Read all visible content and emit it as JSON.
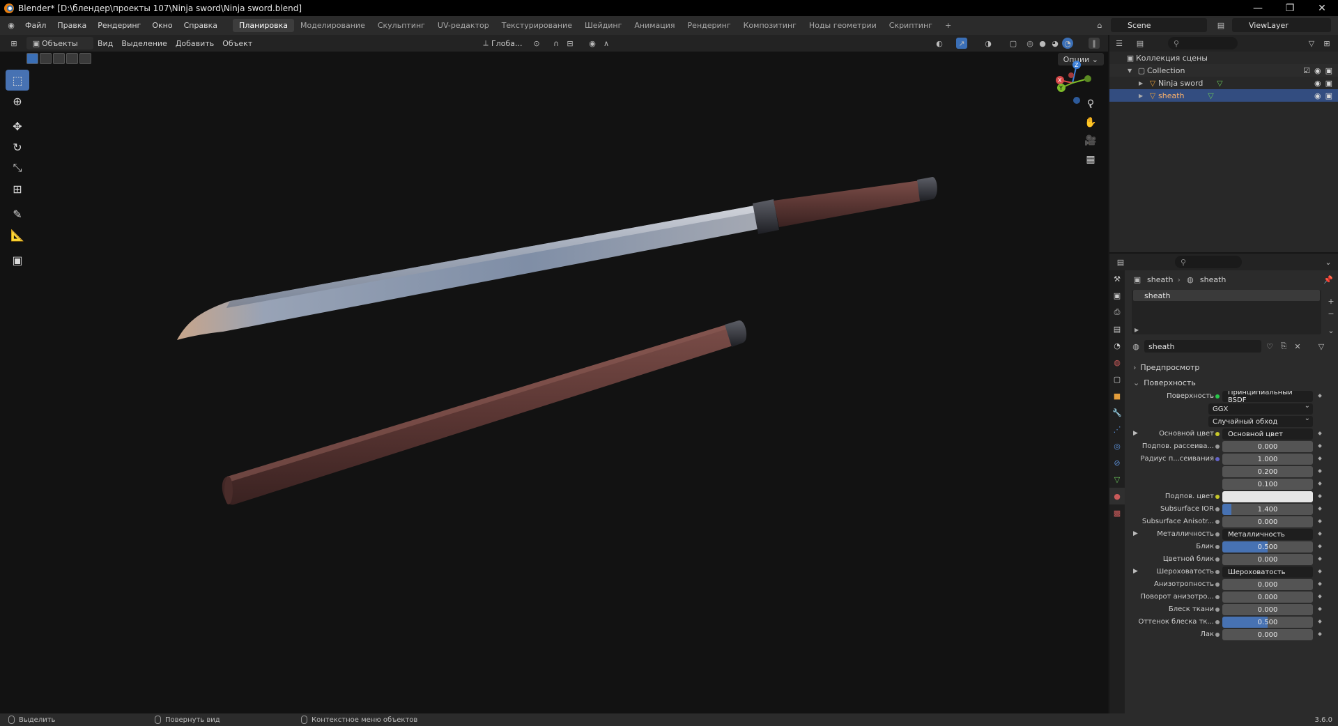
{
  "window": {
    "title": "Blender* [D:\\блендер\\проекты 107\\Ninja sword\\Ninja sword.blend]"
  },
  "menu": [
    "Файл",
    "Правка",
    "Рендеринг",
    "Окно",
    "Справка"
  ],
  "workspaces": [
    {
      "label": "Планировка",
      "active": true
    },
    {
      "label": "Моделирование"
    },
    {
      "label": "Скульптинг"
    },
    {
      "label": "UV-редактор"
    },
    {
      "label": "Текстурирование"
    },
    {
      "label": "Шейдинг"
    },
    {
      "label": "Анимация"
    },
    {
      "label": "Рендеринг"
    },
    {
      "label": "Композитинг"
    },
    {
      "label": "Ноды геометрии"
    },
    {
      "label": "Скриптинг"
    }
  ],
  "add_workspace": "+",
  "scene": {
    "name": "Scene",
    "view_layer": "ViewLayer"
  },
  "viewport_header": {
    "mode": "Объекты",
    "menus": [
      "Вид",
      "Выделение",
      "Добавить",
      "Объект"
    ],
    "transform_orientation": "Глоба...",
    "options": "Опции"
  },
  "outliner": {
    "root": "Коллекция сцены",
    "items": [
      {
        "label": "Collection",
        "level": 1
      },
      {
        "label": "Ninja sword",
        "level": 2
      },
      {
        "label": "sheath",
        "level": 2,
        "selected": true
      }
    ]
  },
  "properties": {
    "breadcrumb": {
      "object": "sheath",
      "material": "sheath"
    },
    "slot": "sheath",
    "material_name": "sheath",
    "panels": {
      "preview": "Предпросмотр",
      "surface": "Поверхность"
    },
    "rows": [
      {
        "label": "Поверхность",
        "value": "Принципиальный BSDF",
        "kind": "shader",
        "dot": "green"
      },
      {
        "label": "",
        "value": "GGX",
        "kind": "dropdown"
      },
      {
        "label": "",
        "value": "Случайный обход",
        "kind": "dropdown"
      },
      {
        "label": "Основной цвет",
        "value": "Основной цвет",
        "kind": "link",
        "dot": "yellow",
        "expand": true
      },
      {
        "label": "Подпов. рассеива...",
        "value": "0.000",
        "kind": "number",
        "dot": "grey"
      },
      {
        "label": "Радиус п...сеивания",
        "value": "1.000",
        "kind": "number",
        "dot": "blue"
      },
      {
        "label": "",
        "value": "0.200",
        "kind": "number"
      },
      {
        "label": "",
        "value": "0.100",
        "kind": "number"
      },
      {
        "label": "Подпов. цвет",
        "value": "",
        "kind": "color",
        "dot": "yellow"
      },
      {
        "label": "Subsurface IOR",
        "value": "1.400",
        "kind": "number",
        "dot": "grey",
        "fill": 0.1
      },
      {
        "label": "Subsurface Anisotr...",
        "value": "0.000",
        "kind": "number",
        "dot": "grey"
      },
      {
        "label": "Металличность",
        "value": "Металличность",
        "kind": "link",
        "dot": "grey",
        "expand": true
      },
      {
        "label": "Блик",
        "value": "0.500",
        "kind": "number",
        "dot": "grey",
        "fill": 0.5
      },
      {
        "label": "Цветной блик",
        "value": "0.000",
        "kind": "number",
        "dot": "grey"
      },
      {
        "label": "Шероховатость",
        "value": "Шероховатость",
        "kind": "link",
        "dot": "grey",
        "expand": true
      },
      {
        "label": "Анизотропность",
        "value": "0.000",
        "kind": "number",
        "dot": "grey"
      },
      {
        "label": "Поворот анизотро...",
        "value": "0.000",
        "kind": "number",
        "dot": "grey"
      },
      {
        "label": "Блеск ткани",
        "value": "0.000",
        "kind": "number",
        "dot": "grey"
      },
      {
        "label": "Оттенок блеска тк...",
        "value": "0.500",
        "kind": "number",
        "dot": "grey",
        "fill": 0.5
      },
      {
        "label": "Лак",
        "value": "0.000",
        "kind": "number",
        "dot": "grey"
      }
    ]
  },
  "statusbar": {
    "select": "Выделить",
    "rotate_view": "Повернуть вид",
    "context_menu": "Контекстное меню объектов",
    "version": "3.6.0"
  },
  "colors": {
    "accent": "#4772b3",
    "selected_row": "#334d80",
    "blade": "#8c96a8",
    "sheath": "#5a3a36"
  }
}
